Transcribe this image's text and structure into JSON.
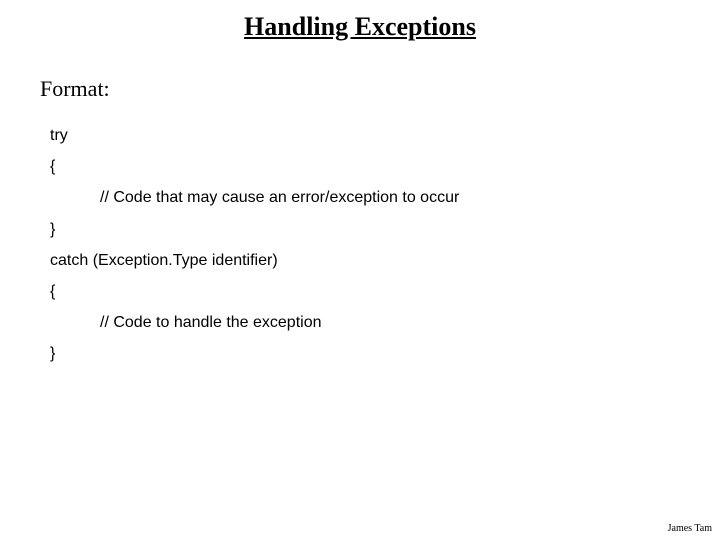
{
  "title": "Handling Exceptions",
  "format_label": "Format:",
  "code": {
    "l1": "try",
    "l2": "{",
    "l3": "// Code that may cause an error/exception to occur",
    "l4": "}",
    "l5": "catch (Exception.Type identifier)",
    "l6": "{",
    "l7": "// Code to handle the exception",
    "l8": "}"
  },
  "footer": "James Tam"
}
